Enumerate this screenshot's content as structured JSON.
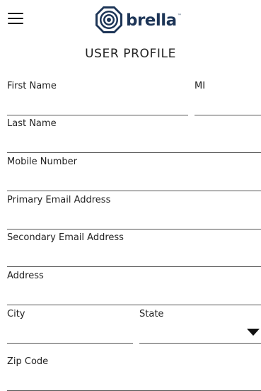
{
  "header": {
    "logo_text": "brella",
    "logo_tm": "™",
    "menu_icon": "hamburger-menu-icon"
  },
  "page": {
    "title": "USER PROFILE"
  },
  "form": {
    "first_name": {
      "label": "First Name",
      "value": ""
    },
    "mi": {
      "label": "MI",
      "value": ""
    },
    "last_name": {
      "label": "Last Name",
      "value": ""
    },
    "mobile_number": {
      "label": "Mobile Number",
      "value": ""
    },
    "primary_email": {
      "label": "Primary Email Address",
      "value": ""
    },
    "secondary_email": {
      "label": "Secondary Email Address",
      "value": ""
    },
    "address": {
      "label": "Address",
      "value": ""
    },
    "city": {
      "label": "City",
      "value": ""
    },
    "state": {
      "label": "State",
      "value": ""
    },
    "zip_code": {
      "label": "Zip Code",
      "value": ""
    }
  },
  "colors": {
    "brand": "#1d3557",
    "text": "#222222",
    "underline": "#555555"
  }
}
